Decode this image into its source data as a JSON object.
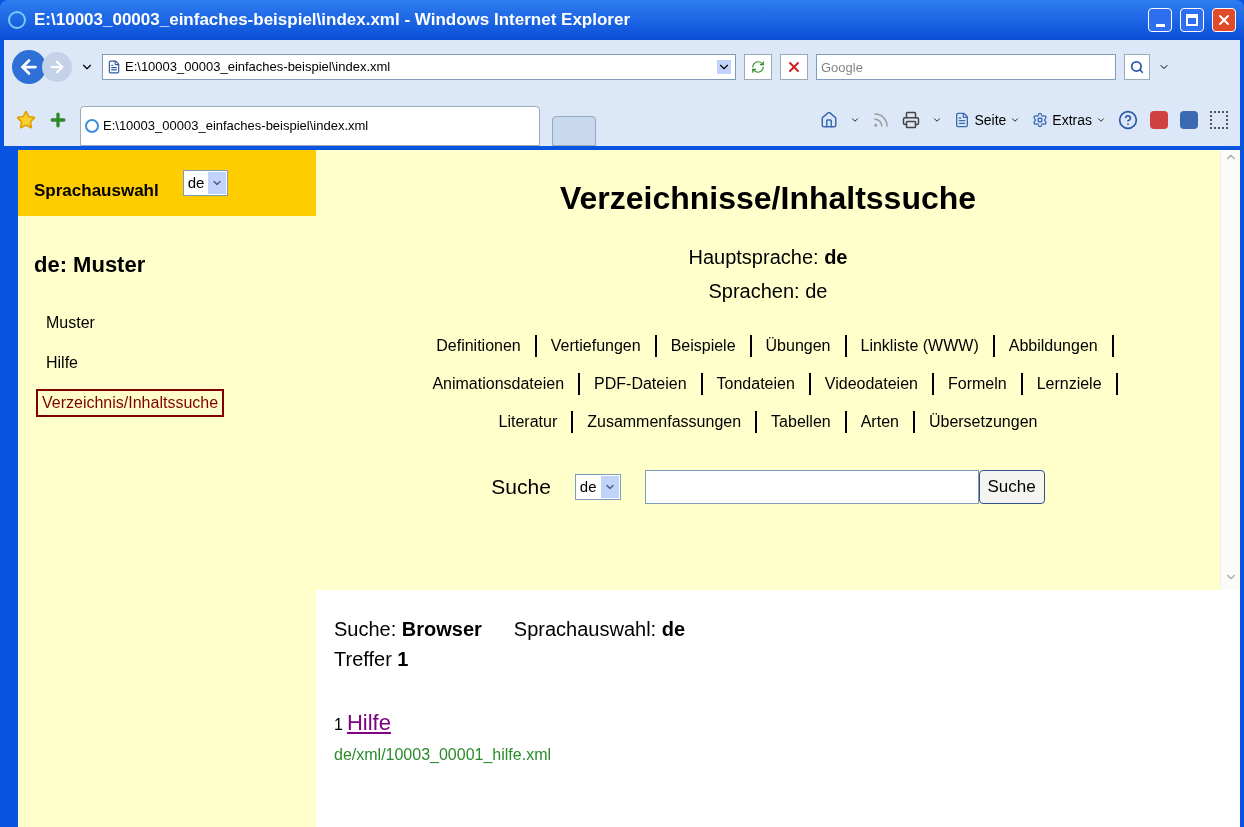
{
  "window": {
    "title": "E:\\10003_00003_einfaches-beispiel\\index.xml - Windows Internet Explorer"
  },
  "address_bar": {
    "value": "E:\\10003_00003_einfaches-beispiel\\index.xml"
  },
  "search": {
    "placeholder": "Google"
  },
  "tab": {
    "label": "E:\\10003_00003_einfaches-beispiel\\index.xml",
    "selected": true
  },
  "toolbar": {
    "page_menu": "Seite",
    "tools_menu": "Extras"
  },
  "sidebar": {
    "language_label": "Sprachauswahl",
    "language_value": "de",
    "heading": "de: Muster",
    "items": [
      {
        "label": "Muster",
        "selected": false
      },
      {
        "label": "Hilfe",
        "selected": false
      },
      {
        "label": "Verzeichnis/Inhaltssuche",
        "selected": true
      }
    ]
  },
  "main": {
    "title": "Verzeichnisse/Inhaltssuche",
    "main_language_label": "Hauptsprache:",
    "main_language": "de",
    "languages": "Sprachen: de",
    "nav_rows": [
      [
        "Definitionen",
        "Vertiefungen",
        "Beispiele",
        "Übungen",
        "Linkliste (WWW)",
        "Abbildungen"
      ],
      [
        "Animationsdateien",
        "PDF-Dateien",
        "Tondateien",
        "Videodateien",
        "Formeln",
        "Lernziele"
      ],
      [
        "Literatur",
        "Zusammenfassungen",
        "Tabellen",
        "Arten",
        "Übersetzungen"
      ]
    ],
    "search_label": "Suche",
    "search_language": "de",
    "search_button": "Suche"
  },
  "results": {
    "search_label": "Suche:",
    "search_term": "Browser",
    "language_label": "Sprachauswahl:",
    "language": "de",
    "hits_label": "Treffer",
    "hits": "1",
    "items": [
      {
        "number": "1",
        "title": "Hilfe",
        "path": "de/xml/10003_00001_hilfe.xml"
      }
    ]
  }
}
